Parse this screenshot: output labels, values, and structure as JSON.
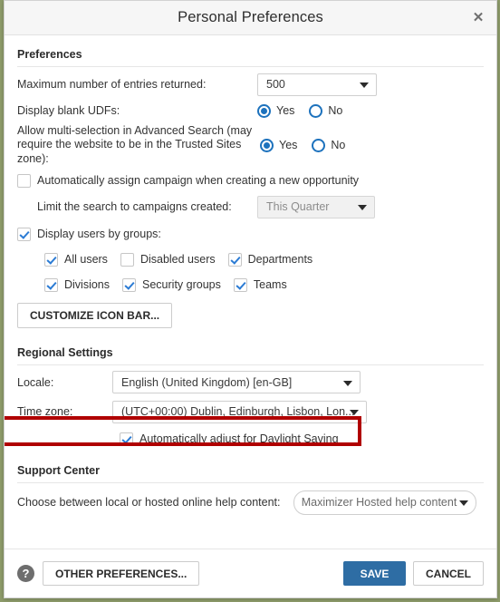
{
  "dialog": {
    "title": "Personal Preferences",
    "close_icon": "close-icon"
  },
  "sections": {
    "preferences": {
      "heading": "Preferences",
      "max_entries": {
        "label": "Maximum number of entries returned:",
        "value": "500"
      },
      "display_blank_udfs": {
        "label": "Display blank UDFs:",
        "yes_label": "Yes",
        "no_label": "No",
        "selected": "Yes"
      },
      "multi_selection": {
        "label": "Allow multi-selection in Advanced Search (may require the website to be in the Trusted Sites zone):",
        "yes_label": "Yes",
        "no_label": "No",
        "selected": "Yes"
      },
      "auto_assign_campaign": {
        "label": "Automatically assign campaign when creating a new opportunity",
        "checked": false
      },
      "limit_search": {
        "label": "Limit the search to campaigns created:",
        "value": "This Quarter",
        "disabled": true
      },
      "display_users_by_groups": {
        "label": "Display users by groups:",
        "checked": true
      },
      "group_options_row1": [
        {
          "label": "All users",
          "checked": true
        },
        {
          "label": "Disabled users",
          "checked": false
        },
        {
          "label": "Departments",
          "checked": true
        }
      ],
      "group_options_row2": [
        {
          "label": "Divisions",
          "checked": true
        },
        {
          "label": "Security groups",
          "checked": true
        },
        {
          "label": "Teams",
          "checked": true
        }
      ],
      "customize_icon_bar_label": "CUSTOMIZE ICON BAR..."
    },
    "regional": {
      "heading": "Regional Settings",
      "locale": {
        "label": "Locale:",
        "value": "English (United Kingdom) [en-GB]"
      },
      "time_zone": {
        "label": "Time zone:",
        "value": "(UTC+00:00) Dublin, Edinburgh, Lisbon, Lon..."
      },
      "dst": {
        "label": "Automatically adjust for Daylight Saving",
        "checked": true
      }
    },
    "support": {
      "heading": "Support Center",
      "help_content": {
        "label": "Choose between local or hosted online help content:",
        "value": "Maximizer Hosted help content"
      }
    }
  },
  "footer": {
    "help_icon_glyph": "?",
    "other_preferences_label": "OTHER PREFERENCES...",
    "save_label": "SAVE",
    "cancel_label": "CANCEL"
  },
  "annotation": {
    "highlight_color": "#b00000",
    "target": "locale-row"
  },
  "colors": {
    "primary_button": "#2e6da4",
    "accent_control": "#1d72bd",
    "header_background": "#f6f6f6",
    "page_background": "#8d9b6a"
  }
}
